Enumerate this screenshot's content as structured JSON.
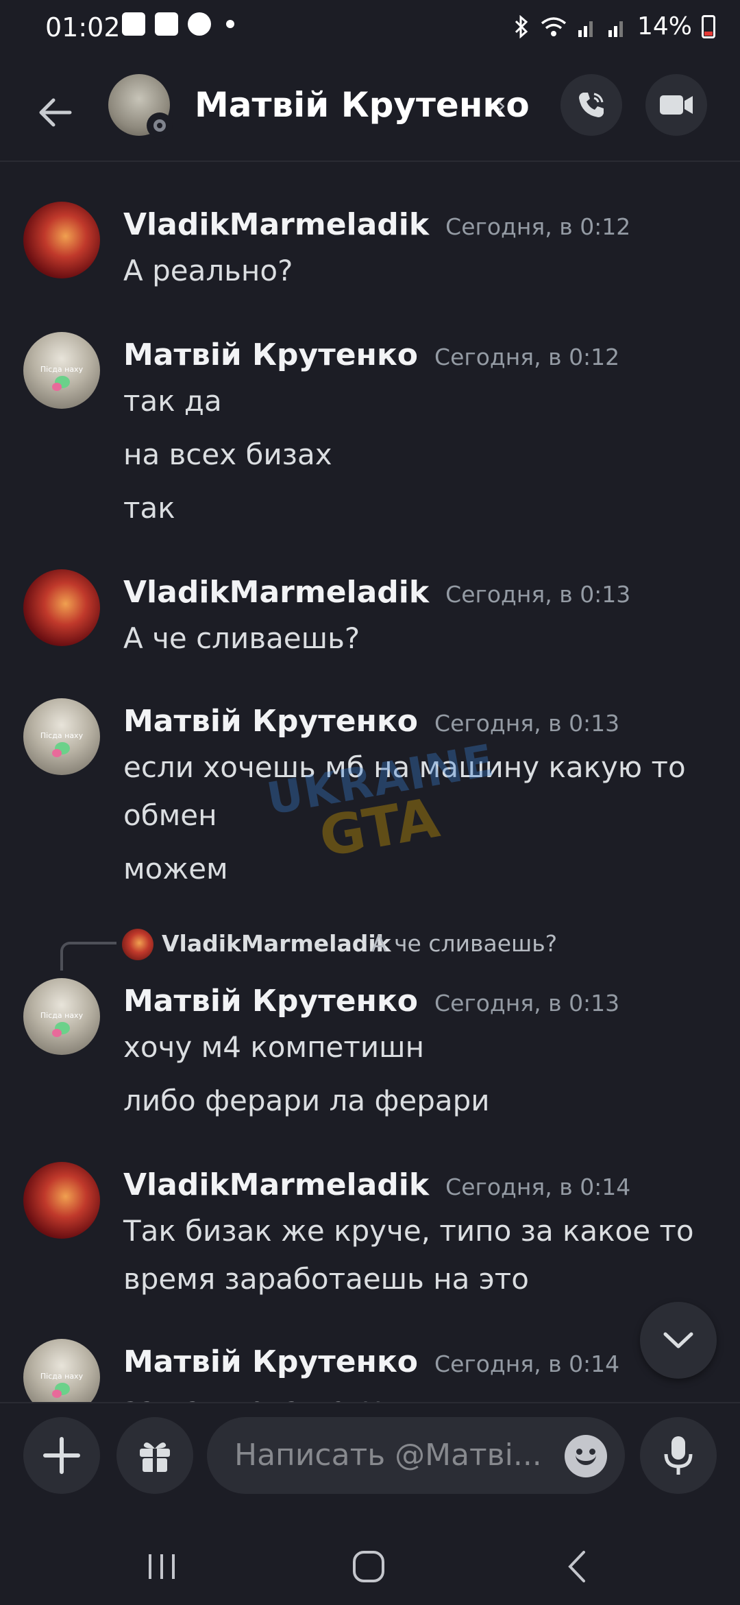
{
  "status_bar": {
    "time": "01:02",
    "battery": "14%"
  },
  "header": {
    "title": "Матвій Крутенко",
    "chevron": "›"
  },
  "messages": [
    {
      "user": "VladikMarmeladik",
      "time": "Сегодня, в 0:12",
      "lines": [
        "А реально?"
      ]
    },
    {
      "user": "Матвій Крутенко",
      "time": "Сегодня, в 0:12",
      "avatar_text": "Пісда наху",
      "lines": [
        "так да",
        "на всех бизах",
        "так"
      ]
    },
    {
      "user": "VladikMarmeladik",
      "time": "Сегодня, в 0:13",
      "lines": [
        "А че сливаешь?"
      ]
    },
    {
      "user": "Матвій Крутенко",
      "time": "Сегодня, в 0:13",
      "avatar_text": "Пісда наху",
      "lines": [
        "если хочешь мб на машину какую то",
        "обмен",
        "можем"
      ]
    },
    {
      "user": "Матвій Крутенко",
      "time": "Сегодня, в 0:13",
      "avatar_text": "Пісда наху",
      "reply": {
        "user": "VladikMarmeladik",
        "text": "А че сливаешь?"
      },
      "lines": [
        "хочу м4 компетишн",
        "либо ферари ла ферари"
      ]
    },
    {
      "user": "VladikMarmeladik",
      "time": "Сегодня, в 0:14",
      "lines": [
        "Так бизак же круче, типо за какое то",
        "время заработаешь на это"
      ]
    },
    {
      "user": "Матвій Крутенко",
      "time": "Сегодня, в 0:14",
      "avatar_text": "Пісда наху",
      "lines": [
        "за нал пока нету"
      ]
    }
  ],
  "watermark": {
    "line1": "UKRAINE",
    "line2": "GTA"
  },
  "composer": {
    "placeholder": "Написать @Матві..."
  },
  "icons": [
    "arrow-left-icon",
    "phone-icon",
    "video-camera-icon",
    "plus-icon",
    "gift-icon",
    "emoji-icon",
    "microphone-icon",
    "chevron-down-icon",
    "recents-icon",
    "home-icon",
    "back-icon"
  ]
}
